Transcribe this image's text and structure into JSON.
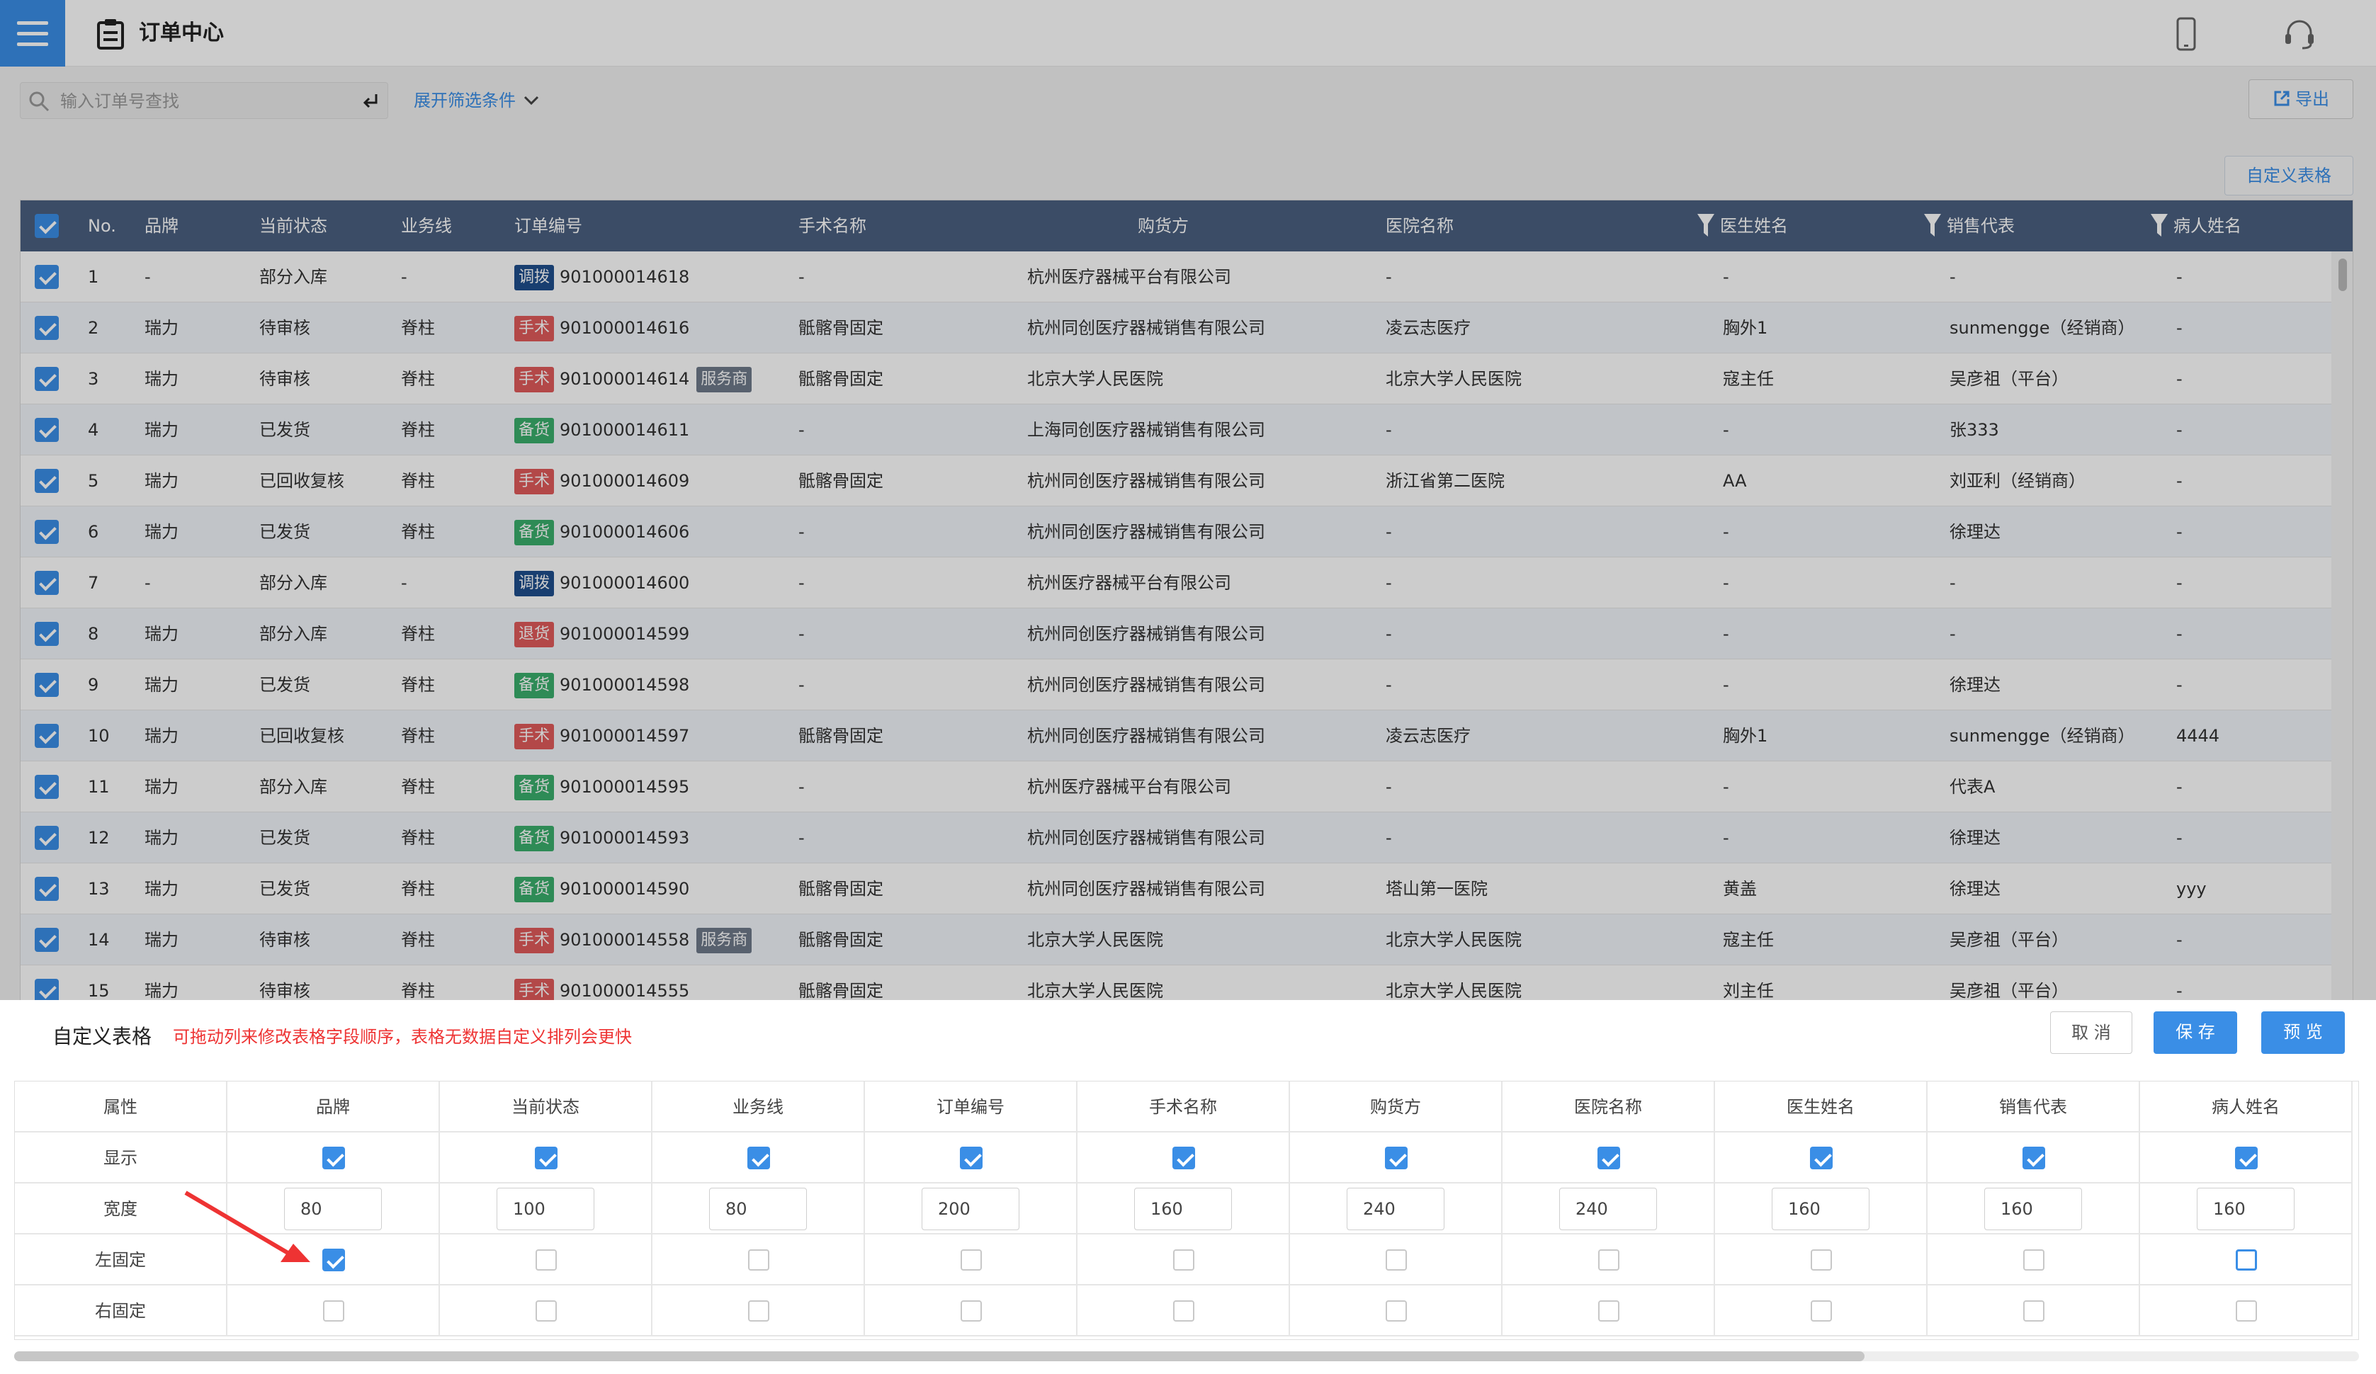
{
  "header": {
    "title": "订单中心"
  },
  "toolbar": {
    "search_placeholder": "输入订单号查找",
    "filter_label": "展开筛选条件",
    "export_label": "导出"
  },
  "custom_table_button": "自定义表格",
  "table": {
    "headers": [
      "No.",
      "品牌",
      "当前状态",
      "业务线",
      "订单编号",
      "手术名称",
      "购货方",
      "医院名称",
      "医生姓名",
      "销售代表",
      "病人姓名"
    ],
    "rows": [
      {
        "no": "1",
        "brand": "-",
        "status": "部分入库",
        "line": "-",
        "tag": "调拨",
        "tag_type": "t-tb",
        "order": "901000014618",
        "svc": "",
        "surgery": "-",
        "buyer": "杭州医疗器械平台有限公司",
        "hospital": "-",
        "doctor": "-",
        "sales": "-",
        "patient": "-"
      },
      {
        "no": "2",
        "brand": "瑞力",
        "status": "待审核",
        "line": "脊柱",
        "tag": "手术",
        "tag_type": "t-ss",
        "order": "901000014616",
        "svc": "",
        "surgery": "骶髂骨固定",
        "buyer": "杭州同创医疗器械销售有限公司",
        "hospital": "凌云志医疗",
        "doctor": "胸外1",
        "sales": "sunmengge（经销商）",
        "patient": "-"
      },
      {
        "no": "3",
        "brand": "瑞力",
        "status": "待审核",
        "line": "脊柱",
        "tag": "手术",
        "tag_type": "t-ss",
        "order": "901000014614",
        "svc": "服务商",
        "surgery": "骶髂骨固定",
        "buyer": "北京大学人民医院",
        "hospital": "北京大学人民医院",
        "doctor": "寇主任",
        "sales": "吴彦祖（平台）",
        "patient": "-"
      },
      {
        "no": "4",
        "brand": "瑞力",
        "status": "已发货",
        "line": "脊柱",
        "tag": "备货",
        "tag_type": "t-bh",
        "order": "901000014611",
        "svc": "",
        "surgery": "-",
        "buyer": "上海同创医疗器械销售有限公司",
        "hospital": "-",
        "doctor": "-",
        "sales": "张333",
        "patient": "-"
      },
      {
        "no": "5",
        "brand": "瑞力",
        "status": "已回收复核",
        "line": "脊柱",
        "tag": "手术",
        "tag_type": "t-ss",
        "order": "901000014609",
        "svc": "",
        "surgery": "骶髂骨固定",
        "buyer": "杭州同创医疗器械销售有限公司",
        "hospital": "浙江省第二医院",
        "doctor": "AA",
        "sales": "刘亚利（经销商）",
        "patient": "-"
      },
      {
        "no": "6",
        "brand": "瑞力",
        "status": "已发货",
        "line": "脊柱",
        "tag": "备货",
        "tag_type": "t-bh",
        "order": "901000014606",
        "svc": "",
        "surgery": "-",
        "buyer": "杭州同创医疗器械销售有限公司",
        "hospital": "-",
        "doctor": "-",
        "sales": "徐理达",
        "patient": "-"
      },
      {
        "no": "7",
        "brand": "-",
        "status": "部分入库",
        "line": "-",
        "tag": "调拨",
        "tag_type": "t-tb",
        "order": "901000014600",
        "svc": "",
        "surgery": "-",
        "buyer": "杭州医疗器械平台有限公司",
        "hospital": "-",
        "doctor": "-",
        "sales": "-",
        "patient": "-"
      },
      {
        "no": "8",
        "brand": "瑞力",
        "status": "部分入库",
        "line": "脊柱",
        "tag": "退货",
        "tag_type": "t-th",
        "order": "901000014599",
        "svc": "",
        "surgery": "-",
        "buyer": "杭州同创医疗器械销售有限公司",
        "hospital": "-",
        "doctor": "-",
        "sales": "-",
        "patient": "-"
      },
      {
        "no": "9",
        "brand": "瑞力",
        "status": "已发货",
        "line": "脊柱",
        "tag": "备货",
        "tag_type": "t-bh",
        "order": "901000014598",
        "svc": "",
        "surgery": "-",
        "buyer": "杭州同创医疗器械销售有限公司",
        "hospital": "-",
        "doctor": "-",
        "sales": "徐理达",
        "patient": "-"
      },
      {
        "no": "10",
        "brand": "瑞力",
        "status": "已回收复核",
        "line": "脊柱",
        "tag": "手术",
        "tag_type": "t-ss",
        "order": "901000014597",
        "svc": "",
        "surgery": "骶髂骨固定",
        "buyer": "杭州同创医疗器械销售有限公司",
        "hospital": "凌云志医疗",
        "doctor": "胸外1",
        "sales": "sunmengge（经销商）",
        "patient": "4444"
      },
      {
        "no": "11",
        "brand": "瑞力",
        "status": "部分入库",
        "line": "脊柱",
        "tag": "备货",
        "tag_type": "t-bh",
        "order": "901000014595",
        "svc": "",
        "surgery": "-",
        "buyer": "杭州医疗器械平台有限公司",
        "hospital": "-",
        "doctor": "-",
        "sales": "代表A",
        "patient": "-"
      },
      {
        "no": "12",
        "brand": "瑞力",
        "status": "已发货",
        "line": "脊柱",
        "tag": "备货",
        "tag_type": "t-bh",
        "order": "901000014593",
        "svc": "",
        "surgery": "-",
        "buyer": "杭州同创医疗器械销售有限公司",
        "hospital": "-",
        "doctor": "-",
        "sales": "徐理达",
        "patient": "-"
      },
      {
        "no": "13",
        "brand": "瑞力",
        "status": "已发货",
        "line": "脊柱",
        "tag": "备货",
        "tag_type": "t-bh",
        "order": "901000014590",
        "svc": "",
        "surgery": "骶髂骨固定",
        "buyer": "杭州同创医疗器械销售有限公司",
        "hospital": "塔山第一医院",
        "doctor": "黄盖",
        "sales": "徐理达",
        "patient": "yyy"
      },
      {
        "no": "14",
        "brand": "瑞力",
        "status": "待审核",
        "line": "脊柱",
        "tag": "手术",
        "tag_type": "t-ss",
        "order": "901000014558",
        "svc": "服务商",
        "surgery": "骶髂骨固定",
        "buyer": "北京大学人民医院",
        "hospital": "北京大学人民医院",
        "doctor": "寇主任",
        "sales": "吴彦祖（平台）",
        "patient": "-"
      },
      {
        "no": "15",
        "brand": "瑞力",
        "status": "待审核",
        "line": "脊柱",
        "tag": "手术",
        "tag_type": "t-ss",
        "order": "901000014555",
        "svc": "",
        "surgery": "骶髂骨固定",
        "buyer": "北京大学人民医院",
        "hospital": "北京大学人民医院",
        "doctor": "刘主任",
        "sales": "吴彦祖（平台）",
        "patient": "-"
      }
    ]
  },
  "panel": {
    "title": "自定义表格",
    "hint": "可拖动列来修改表格字段顺序，表格无数据自定义排列会更快",
    "cancel": "取 消",
    "save": "保 存",
    "preview": "预 览",
    "row_labels": [
      "属性",
      "显示",
      "宽度",
      "左固定",
      "右固定"
    ],
    "columns": [
      {
        "name": "品牌",
        "show": true,
        "width": "80",
        "left_fixed": true,
        "right_fixed": false
      },
      {
        "name": "当前状态",
        "show": true,
        "width": "100",
        "left_fixed": false,
        "right_fixed": false
      },
      {
        "name": "业务线",
        "show": true,
        "width": "80",
        "left_fixed": false,
        "right_fixed": false
      },
      {
        "name": "订单编号",
        "show": true,
        "width": "200",
        "left_fixed": false,
        "right_fixed": false
      },
      {
        "name": "手术名称",
        "show": true,
        "width": "160",
        "left_fixed": false,
        "right_fixed": false
      },
      {
        "name": "购货方",
        "show": true,
        "width": "240",
        "left_fixed": false,
        "right_fixed": false
      },
      {
        "name": "医院名称",
        "show": true,
        "width": "240",
        "left_fixed": false,
        "right_fixed": false
      },
      {
        "name": "医生姓名",
        "show": true,
        "width": "160",
        "left_fixed": false,
        "right_fixed": false
      },
      {
        "name": "销售代表",
        "show": true,
        "width": "160",
        "left_fixed": false,
        "right_fixed": false
      },
      {
        "name": "病人姓名",
        "show": true,
        "width": "160",
        "left_fixed": false,
        "right_fixed": false
      }
    ]
  },
  "icons": {
    "menu": "menu-icon",
    "title": "clipboard-icon",
    "phone": "phone-icon",
    "headset": "headset-icon",
    "search": "search-icon",
    "enter": "enter-icon",
    "chevron": "chevron-down-icon",
    "export": "export-icon",
    "filter": "filter-icon",
    "annotation": "red-arrow-annotation"
  },
  "colors": {
    "accent": "#3a8ee6",
    "header_bg": "#4a5f80",
    "tag_transfer": "#1f4e8c",
    "tag_surgery": "#e05a5a",
    "tag_stock": "#3aae6c",
    "tag_service": "#6f7a8a",
    "hint": "#e33",
    "arrow": "#e33"
  }
}
